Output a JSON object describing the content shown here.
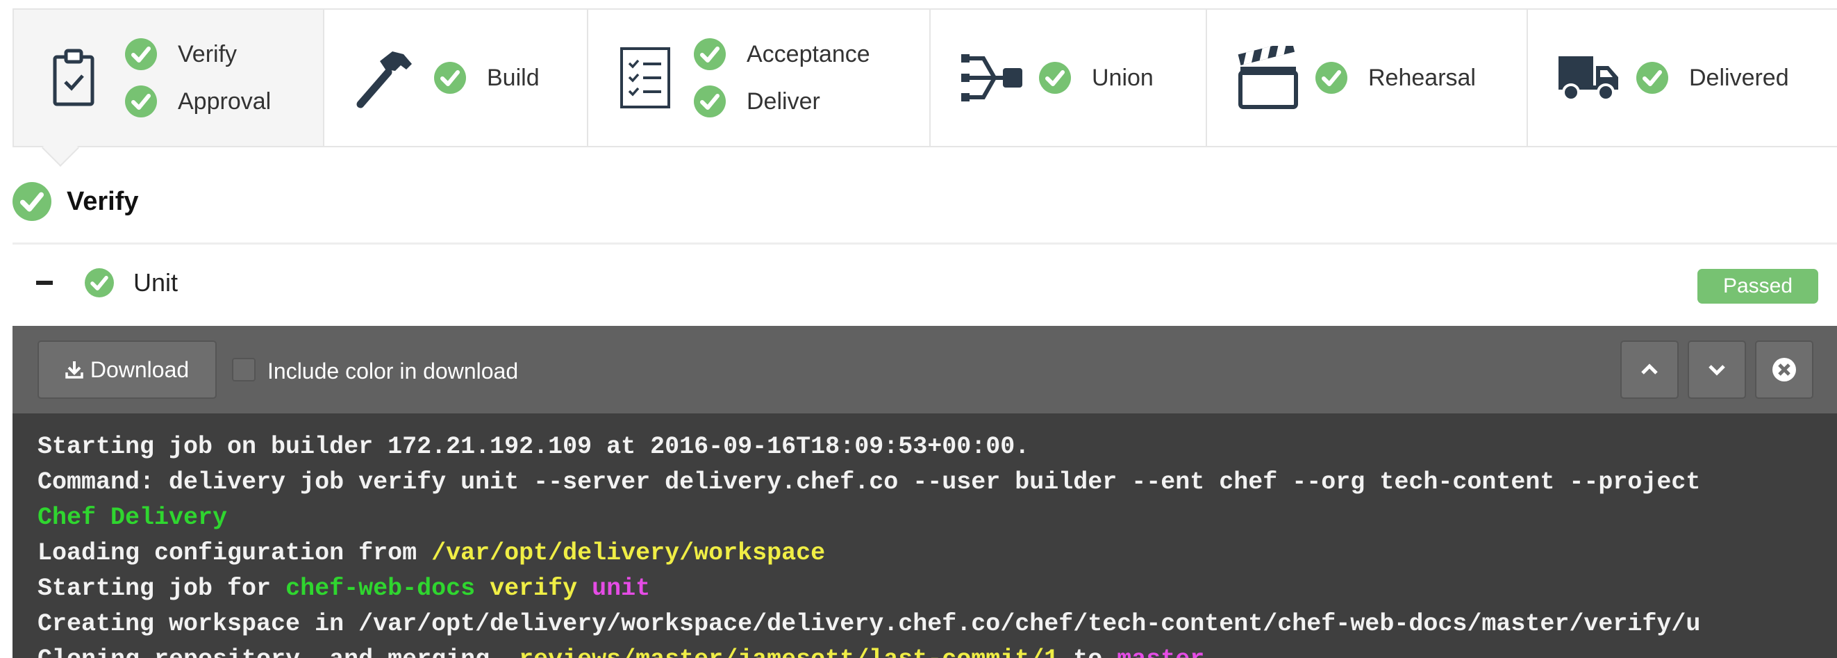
{
  "stages": [
    {
      "id": "verify-approval",
      "icon": "clipboard-check-icon",
      "labels": [
        "Verify",
        "Approval"
      ]
    },
    {
      "id": "build",
      "icon": "hammer-icon",
      "labels": [
        "Build"
      ]
    },
    {
      "id": "acceptance-deliver",
      "icon": "checklist-icon",
      "labels": [
        "Acceptance",
        "Deliver"
      ]
    },
    {
      "id": "union",
      "icon": "union-icon",
      "labels": [
        "Union"
      ]
    },
    {
      "id": "rehearsal",
      "icon": "clapperboard-icon",
      "labels": [
        "Rehearsal"
      ]
    },
    {
      "id": "delivered",
      "icon": "truck-icon",
      "labels": [
        "Delivered"
      ]
    }
  ],
  "phase": {
    "title": "Verify"
  },
  "unit": {
    "name": "Unit",
    "status": "Passed"
  },
  "toolbar": {
    "download_label": "Download",
    "include_color_label": "Include color in download",
    "include_color_checked": false
  },
  "colors": {
    "success": "#77c272",
    "log_green": "#2fd62f",
    "log_yellow": "#f0ee45",
    "log_magenta": "#e54ce5"
  },
  "log": {
    "line1": "Starting job on builder 172.21.192.109 at 2016-09-16T18:09:53+00:00.",
    "line2": "Command: delivery job verify unit --server delivery.chef.co --user builder --ent chef --org tech-content --project",
    "line3": "Chef Delivery",
    "line4_a": "Loading configuration from ",
    "line4_b": "/var/opt/delivery/workspace",
    "line5_a": "Starting job for ",
    "line5_b": "chef-web-docs",
    "line5_c": "verify",
    "line5_d": "unit",
    "line6": "Creating workspace in /var/opt/delivery/workspace/delivery.chef.co/chef/tech-content/chef-web-docs/master/verify/u",
    "line7_a": "Cloning repository, and merging ",
    "line7_b": "_reviews/master/jamesott/last-commit/1",
    "line7_c": " to ",
    "line7_d": "master"
  }
}
